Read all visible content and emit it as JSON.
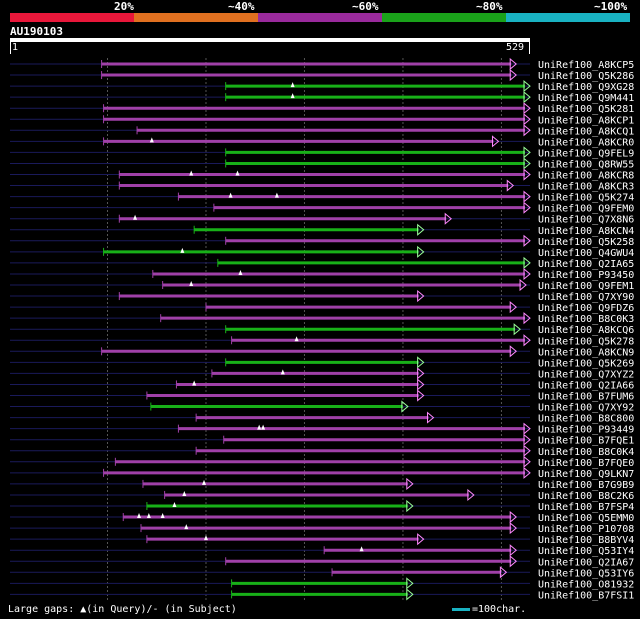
{
  "header": {
    "pct_labels": [
      "20%",
      "~40%",
      "~60%",
      "~80%",
      "~100%"
    ],
    "colors": [
      "#e8173a",
      "#e07020",
      "#9a2a9c",
      "#1aa21a",
      "#19b2c2"
    ],
    "query_id": "AU190103"
  },
  "ruler": {
    "start": "1",
    "end": "529"
  },
  "colors": {
    "purple": "#a040a8",
    "green": "#18b018",
    "faint": "#1a1a5a",
    "pink": "#ff88ff",
    "lightgreen": "#99ff99"
  },
  "hits": [
    {
      "label": "UniRef100_A8KCP5",
      "color": "purple",
      "s": 94,
      "e": 515,
      "gaps": [],
      "tri": []
    },
    {
      "label": "UniRef100_Q5K286",
      "color": "purple",
      "s": 94,
      "e": 515,
      "gaps": [],
      "tri": []
    },
    {
      "label": "UniRef100_Q9XG28",
      "color": "green",
      "s": 220,
      "e": 529,
      "gaps": [],
      "tri": [
        288
      ]
    },
    {
      "label": "UniRef100_Q9M441",
      "color": "green",
      "s": 220,
      "e": 529,
      "gaps": [],
      "tri": [
        288
      ]
    },
    {
      "label": "UniRef100_Q5K281",
      "color": "purple",
      "s": 96,
      "e": 529,
      "gaps": [],
      "tri": []
    },
    {
      "label": "UniRef100_A8KCP1",
      "color": "purple",
      "s": 96,
      "e": 529,
      "gaps": [],
      "tri": []
    },
    {
      "label": "UniRef100_A8KCQ1",
      "color": "purple",
      "s": 130,
      "e": 529,
      "gaps": [],
      "tri": []
    },
    {
      "label": "UniRef100_A8KCR0",
      "color": "purple",
      "s": 96,
      "e": 497,
      "gaps": [],
      "tri": [
        145
      ]
    },
    {
      "label": "UniRef100_Q9FEL9",
      "color": "green",
      "s": 220,
      "e": 529,
      "gaps": [],
      "tri": []
    },
    {
      "label": "UniRef100_Q8RW55",
      "color": "green",
      "s": 220,
      "e": 529,
      "gaps": [],
      "tri": []
    },
    {
      "label": "UniRef100_A8KCR8",
      "color": "purple",
      "s": 112,
      "e": 529,
      "gaps": [],
      "tri": [
        185,
        232
      ]
    },
    {
      "label": "UniRef100_A8KCR3",
      "color": "purple",
      "s": 112,
      "e": 512,
      "gaps": [],
      "tri": []
    },
    {
      "label": "UniRef100_Q5K274",
      "color": "purple",
      "s": 172,
      "e": 529,
      "gaps": [],
      "tri": [
        225,
        272
      ]
    },
    {
      "label": "UniRef100_Q9FEM0",
      "color": "purple",
      "s": 208,
      "e": 529,
      "gaps": [],
      "tri": []
    },
    {
      "label": "UniRef100_Q7X8N6",
      "color": "purple",
      "s": 112,
      "e": 449,
      "gaps": [],
      "tri": [
        128
      ]
    },
    {
      "label": "UniRef100_A8KCN4",
      "color": "green",
      "s": 188,
      "e": 421,
      "gaps": [],
      "tri": []
    },
    {
      "label": "UniRef100_Q5K258",
      "color": "purple",
      "s": 220,
      "e": 529,
      "gaps": [],
      "tri": []
    },
    {
      "label": "UniRef100_Q4GWU4",
      "color": "green",
      "s": 96,
      "e": 421,
      "gaps": [],
      "tri": [
        176
      ]
    },
    {
      "label": "UniRef100_Q2IA65",
      "color": "green",
      "s": 212,
      "e": 529,
      "gaps": [],
      "tri": []
    },
    {
      "label": "UniRef100_P93450",
      "color": "purple",
      "s": 146,
      "e": 529,
      "gaps": [],
      "tri": [
        235
      ]
    },
    {
      "label": "UniRef100_Q9FEM1",
      "color": "purple",
      "s": 156,
      "e": 525,
      "gaps": [],
      "tri": [
        185
      ]
    },
    {
      "label": "UniRef100_Q7XY90",
      "color": "purple",
      "s": 112,
      "e": 421,
      "gaps": [],
      "tri": []
    },
    {
      "label": "UniRef100_Q9FDZ6",
      "color": "purple",
      "s": 200,
      "e": 515,
      "gaps": [],
      "tri": []
    },
    {
      "label": "UniRef100_B8C0K3",
      "color": "purple",
      "s": 154,
      "e": 529,
      "gaps": [],
      "tri": []
    },
    {
      "label": "UniRef100_A8KCQ6",
      "color": "green",
      "s": 220,
      "e": 519,
      "gaps": [],
      "tri": []
    },
    {
      "label": "UniRef100_Q5K278",
      "color": "purple",
      "s": 226,
      "e": 529,
      "gaps": [],
      "tri": [
        292
      ]
    },
    {
      "label": "UniRef100_A8KCN9",
      "color": "purple",
      "s": 94,
      "e": 515,
      "gaps": [],
      "tri": []
    },
    {
      "label": "UniRef100_Q5K269",
      "color": "green",
      "s": 220,
      "e": 421,
      "gaps": [],
      "tri": []
    },
    {
      "label": "UniRef100_Q7XYZ2",
      "color": "purple",
      "s": 206,
      "e": 421,
      "gaps": [],
      "tri": [
        278
      ]
    },
    {
      "label": "UniRef100_Q2IA66",
      "color": "purple",
      "s": 170,
      "e": 421,
      "gaps": [],
      "tri": [
        188
      ]
    },
    {
      "label": "UniRef100_B7FUM6",
      "color": "purple",
      "s": 140,
      "e": 421,
      "gaps": [],
      "tri": []
    },
    {
      "label": "UniRef100_Q7XY92",
      "color": "green",
      "s": 144,
      "e": 405,
      "gaps": [],
      "tri": []
    },
    {
      "label": "UniRef100_B8C800",
      "color": "purple",
      "s": 190,
      "e": 431,
      "gaps": [],
      "tri": []
    },
    {
      "label": "UniRef100_P93449",
      "color": "purple",
      "s": 172,
      "e": 529,
      "gaps": [],
      "tri": [
        254,
        258
      ]
    },
    {
      "label": "UniRef100_B7FQE1",
      "color": "purple",
      "s": 218,
      "e": 529,
      "gaps": [],
      "tri": []
    },
    {
      "label": "UniRef100_B8C0K4",
      "color": "purple",
      "s": 190,
      "e": 529,
      "gaps": [],
      "tri": []
    },
    {
      "label": "UniRef100_B7FQE0",
      "color": "purple",
      "s": 108,
      "e": 529,
      "gaps": [],
      "tri": []
    },
    {
      "label": "UniRef100_Q9LKN7",
      "color": "purple",
      "s": 96,
      "e": 529,
      "gaps": [],
      "tri": []
    },
    {
      "label": "UniRef100_B7G9B9",
      "color": "purple",
      "s": 136,
      "e": 410,
      "gaps": [],
      "tri": [
        198
      ]
    },
    {
      "label": "UniRef100_B8C2K6",
      "color": "purple",
      "s": 158,
      "e": 472,
      "gaps": [],
      "tri": [
        178
      ]
    },
    {
      "label": "UniRef100_B7FSP4",
      "color": "green",
      "s": 140,
      "e": 410,
      "gaps": [],
      "tri": [
        168
      ]
    },
    {
      "label": "UniRef100_Q5EMM0",
      "color": "purple",
      "s": 116,
      "e": 515,
      "gaps": [],
      "tri": [
        132,
        142,
        156
      ]
    },
    {
      "label": "UniRef100_P10708",
      "color": "purple",
      "s": 134,
      "e": 515,
      "gaps": [],
      "tri": [
        180
      ]
    },
    {
      "label": "UniRef100_B8BYV4",
      "color": "purple",
      "s": 140,
      "e": 421,
      "gaps": [],
      "tri": [
        200
      ]
    },
    {
      "label": "UniRef100_Q53IY4",
      "color": "purple",
      "s": 320,
      "e": 515,
      "gaps": [],
      "tri": [
        358
      ]
    },
    {
      "label": "UniRef100_Q2IA67",
      "color": "purple",
      "s": 220,
      "e": 515,
      "gaps": [],
      "tri": []
    },
    {
      "label": "UniRef100_Q53IY6",
      "color": "purple",
      "s": 328,
      "e": 505,
      "gaps": [],
      "tri": []
    },
    {
      "label": "UniRef100_O81932",
      "color": "green",
      "s": 226,
      "e": 410,
      "gaps": [],
      "tri": []
    },
    {
      "label": "UniRef100_B7FSI1",
      "color": "green",
      "s": 226,
      "e": 410,
      "gaps": [],
      "tri": []
    }
  ],
  "footer": {
    "text": "Large gaps: ▲(in Query)/- (in Subject)",
    "legend": "=100char."
  }
}
